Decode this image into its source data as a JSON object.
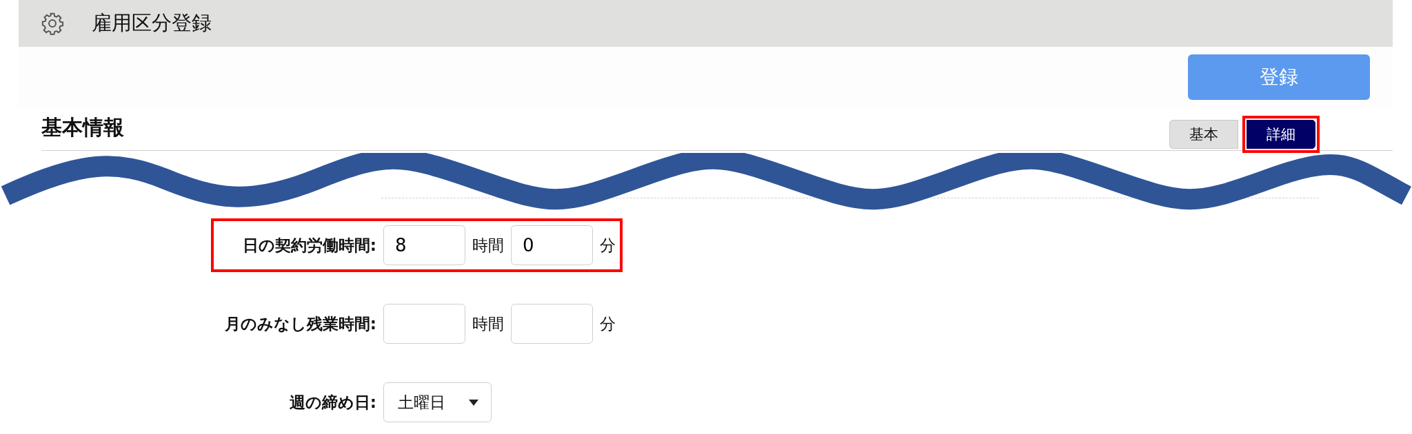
{
  "header": {
    "title": "雇用区分登録"
  },
  "toolbar": {
    "register_button": "登録"
  },
  "section": {
    "title": "基本情報"
  },
  "tabs": [
    {
      "label": "基本",
      "selected": false,
      "highlighted": false
    },
    {
      "label": "詳細",
      "selected": true,
      "highlighted": true
    }
  ],
  "fields": [
    {
      "kind": "duration",
      "label": "日の契約労働時間:",
      "highlighted": true,
      "hours": "8",
      "hours_unit": "時間",
      "minutes": "0",
      "minutes_unit": "分"
    },
    {
      "kind": "duration",
      "label": "月のみなし残業時間:",
      "highlighted": false,
      "hours_unit": "時間",
      "minutes_unit": "分"
    },
    {
      "kind": "select",
      "label": "週の締め日:",
      "highlighted": false,
      "value": "土曜日"
    }
  ]
}
